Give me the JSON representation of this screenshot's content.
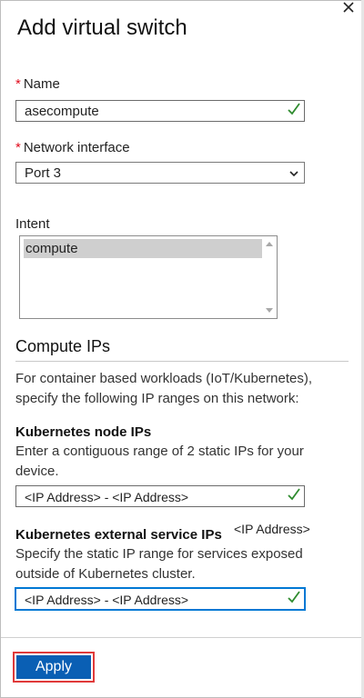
{
  "panel": {
    "title": "Add virtual switch",
    "close_icon": "close-icon"
  },
  "name_field": {
    "required_mark": "*",
    "label": "Name",
    "value": "asecompute",
    "valid": true
  },
  "network_interface": {
    "required_mark": "*",
    "label": "Network interface",
    "selected": "Port 3"
  },
  "intent": {
    "label": "Intent",
    "items": [
      "compute"
    ],
    "selected_index": 0
  },
  "compute_ips": {
    "heading": "Compute IPs",
    "description": "For container based workloads (IoT/Kubernetes), specify the following IP ranges on this network:",
    "node_ips": {
      "heading": "Kubernetes node IPs",
      "description": "Enter a contiguous range of 2 static IPs for your device.",
      "value": "<IP Address> - <IP Address>",
      "valid": true
    },
    "external_ips": {
      "heading": "Kubernetes external service IPs",
      "floating_label": "<IP Address>",
      "description": "Specify the static IP range for services exposed outside of Kubernetes cluster.",
      "value": "<IP Address> - <IP Address>",
      "valid": true
    }
  },
  "footer": {
    "apply_label": "Apply"
  },
  "colors": {
    "accent": "#0a5fb4",
    "required": "#e00b1c",
    "valid_check": "#2e8b2e",
    "highlight_border": "#e03a3a"
  }
}
